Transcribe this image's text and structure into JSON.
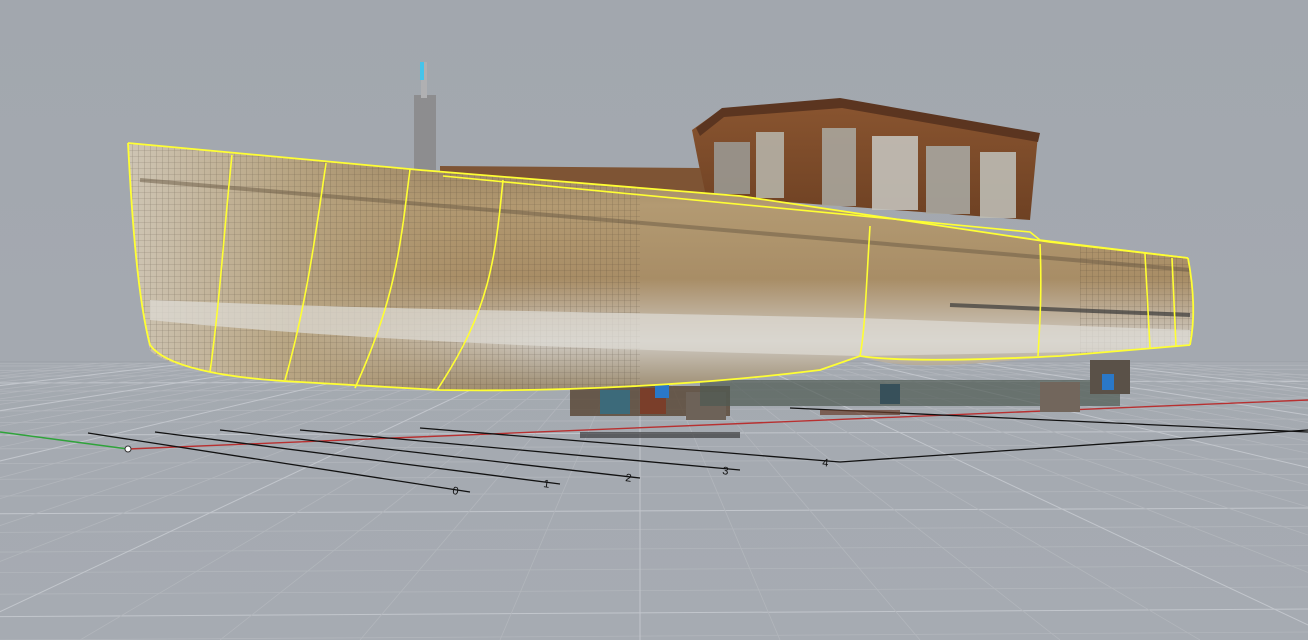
{
  "viewport": {
    "background_color": "#a4a9b0",
    "grid_color": "#c2c6cc",
    "x_axis_color": "#b83030",
    "y_axis_color": "#2fa33a",
    "curve_color": "#ffff33"
  },
  "scene": {
    "hull_stations": 10,
    "section_markers": [
      {
        "label": "0"
      },
      {
        "label": "1"
      },
      {
        "label": "2"
      },
      {
        "label": "3"
      },
      {
        "label": "4"
      }
    ]
  }
}
